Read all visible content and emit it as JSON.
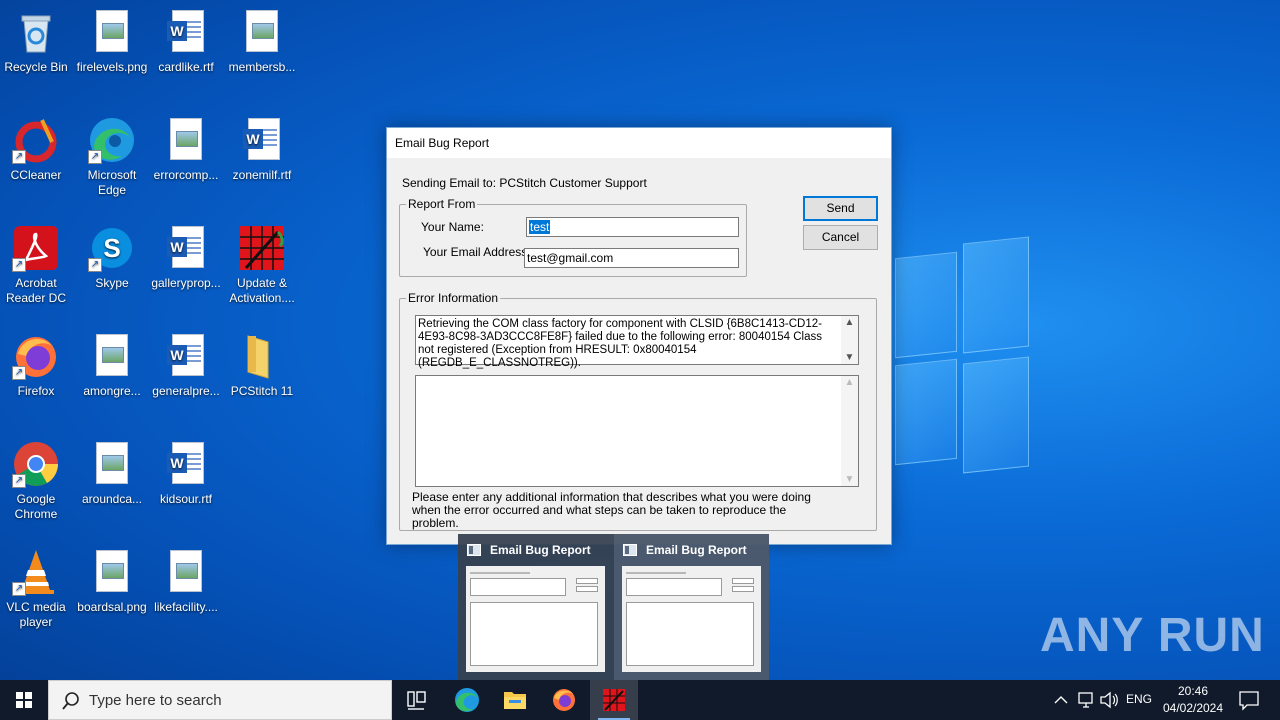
{
  "desktop": {
    "icons": [
      {
        "label": "Recycle Bin"
      },
      {
        "label": "firelevels.png"
      },
      {
        "label": "cardlike.rtf"
      },
      {
        "label": "membersb..."
      },
      {
        "label": "CCleaner"
      },
      {
        "label": "Microsoft Edge"
      },
      {
        "label": "errorcomp..."
      },
      {
        "label": "zonemilf.rtf"
      },
      {
        "label": "Acrobat Reader DC"
      },
      {
        "label": "Skype"
      },
      {
        "label": "galleryprop..."
      },
      {
        "label": "Update & Activation...."
      },
      {
        "label": "Firefox"
      },
      {
        "label": "amongre..."
      },
      {
        "label": "generalpre..."
      },
      {
        "label": "PCStitch 11"
      },
      {
        "label": "Google Chrome"
      },
      {
        "label": "aroundca..."
      },
      {
        "label": "kidsour.rtf"
      },
      {
        "label": "VLC media player"
      },
      {
        "label": "boardsal.png"
      },
      {
        "label": "likefacility...."
      }
    ]
  },
  "dialog": {
    "title": "Email Bug Report",
    "sending_to": "Sending Email to:  PCStitch  Customer Support",
    "report_from": {
      "legend": "Report From",
      "name_label": "Your Name:",
      "name_value": "test",
      "email_label": "Your Email Address:",
      "email_value": "test@gmail.com"
    },
    "buttons": {
      "send": "Send",
      "cancel": "Cancel"
    },
    "error_info": {
      "legend": "Error Information",
      "error_text": "Retrieving the COM class factory for component with CLSID {6B8C1413-CD12-4E93-8C98-3AD3CCC8FE8F} failed due to the following error: 80040154 Class not registered (Exception from HRESULT: 0x80040154 (REGDB_E_CLASSNOTREG)).",
      "additional_text": "",
      "instructions": "Please enter  any additional information  that  describes what  you  were doing when  the error occurred and what steps can be taken to reproduce the problem."
    }
  },
  "previews": [
    {
      "title": "Email Bug Report"
    },
    {
      "title": "Email Bug Report"
    }
  ],
  "watermark": "ANY RUN",
  "taskbar": {
    "search_placeholder": "Type here to search",
    "language": "ENG",
    "time": "20:46",
    "date": "04/02/2024"
  }
}
